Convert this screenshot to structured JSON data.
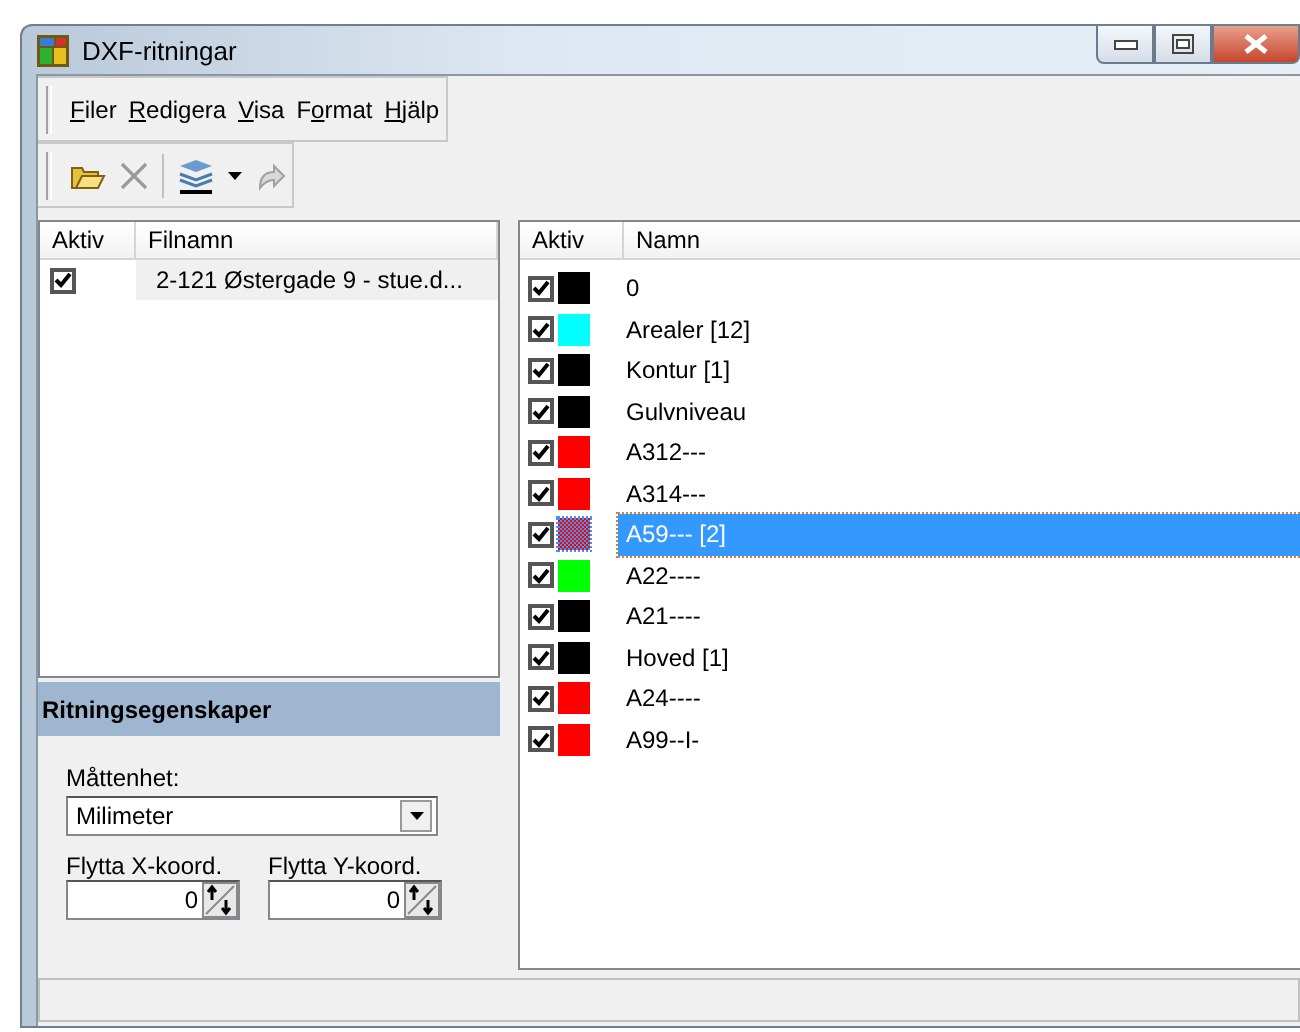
{
  "window": {
    "title": "DXF-ritningar"
  },
  "menu": [
    {
      "key": "F",
      "after": "iler"
    },
    {
      "key": "R",
      "after": "edigera"
    },
    {
      "key": "V",
      "after": "isa"
    },
    {
      "before": "F",
      "key": "o",
      "after": "rmat"
    },
    {
      "key": "H",
      "after": "jälp"
    }
  ],
  "files": {
    "columns": [
      "Aktiv",
      "Filnamn"
    ],
    "rows": [
      {
        "active": true,
        "name": "2-121 Østergade 9 - stue.d..."
      }
    ]
  },
  "properties": {
    "title": "Ritningsegenskaper",
    "unit_label": "Måttenhet:",
    "unit_value": "Milimeter",
    "x_label": "Flytta X-koord.",
    "x_value": "0",
    "y_label": "Flytta Y-koord.",
    "y_value": "0"
  },
  "layers": {
    "columns": [
      "Aktiv",
      "Namn"
    ],
    "rows": [
      {
        "active": true,
        "color": "#000000",
        "name": "0",
        "selected": false
      },
      {
        "active": true,
        "color": "#00ffff",
        "name": "Arealer [12]",
        "selected": false
      },
      {
        "active": true,
        "color": "#000000",
        "name": "Kontur [1]",
        "selected": false
      },
      {
        "active": true,
        "color": "#000000",
        "name": "Gulvniveau",
        "selected": false
      },
      {
        "active": true,
        "color": "#ff0000",
        "name": "A312---",
        "selected": false
      },
      {
        "active": true,
        "color": "#ff0000",
        "name": "A314---",
        "selected": false
      },
      {
        "active": true,
        "color": "#ff0000",
        "name": "A59--- [2]",
        "selected": true
      },
      {
        "active": true,
        "color": "#00ff00",
        "name": "A22----",
        "selected": false
      },
      {
        "active": true,
        "color": "#000000",
        "name": "A21----",
        "selected": false
      },
      {
        "active": true,
        "color": "#000000",
        "name": "Hoved [1]",
        "selected": false
      },
      {
        "active": true,
        "color": "#ff0000",
        "name": "A24----",
        "selected": false
      },
      {
        "active": true,
        "color": "#ff0000",
        "name": "A99--I-",
        "selected": false
      }
    ]
  }
}
